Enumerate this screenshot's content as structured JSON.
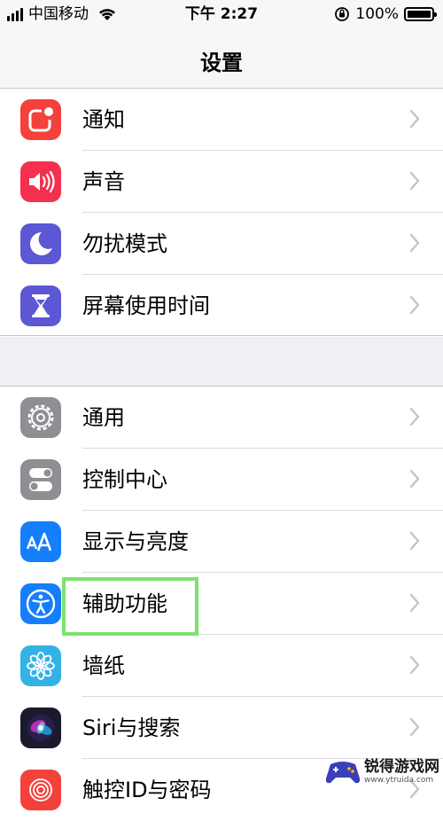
{
  "status_bar": {
    "carrier": "中国移动",
    "time": "下午 2:27",
    "battery": "100%"
  },
  "nav": {
    "title": "设置"
  },
  "groups": [
    {
      "items": [
        {
          "label": "通知",
          "icon": "notifications-icon",
          "color": "#f4413b"
        },
        {
          "label": "声音",
          "icon": "speaker-icon",
          "color": "#f5304f"
        },
        {
          "label": "勿扰模式",
          "icon": "moon-icon",
          "color": "#5b57d5"
        },
        {
          "label": "屏幕使用时间",
          "icon": "hourglass-icon",
          "color": "#5b57d5"
        }
      ]
    },
    {
      "items": [
        {
          "label": "通用",
          "icon": "gear-icon",
          "color": "#8e8e93"
        },
        {
          "label": "控制中心",
          "icon": "toggle-icon",
          "color": "#8e8e93"
        },
        {
          "label": "显示与亮度",
          "icon": "text-size-icon",
          "color": "#157efb"
        },
        {
          "label": "辅助功能",
          "icon": "accessibility-icon",
          "color": "#157efb"
        },
        {
          "label": "墙纸",
          "icon": "flower-icon",
          "color": "#32b2e5"
        },
        {
          "label": "Siri与搜索",
          "icon": "siri-icon",
          "color": "#1a1a2e"
        },
        {
          "label": "触控ID与密码",
          "icon": "fingerprint-icon",
          "color": "#f4413b"
        }
      ]
    }
  ],
  "highlight_color": "#7de26f",
  "watermark": {
    "name": "锐得游戏网",
    "url": "www.ytruida.com"
  }
}
